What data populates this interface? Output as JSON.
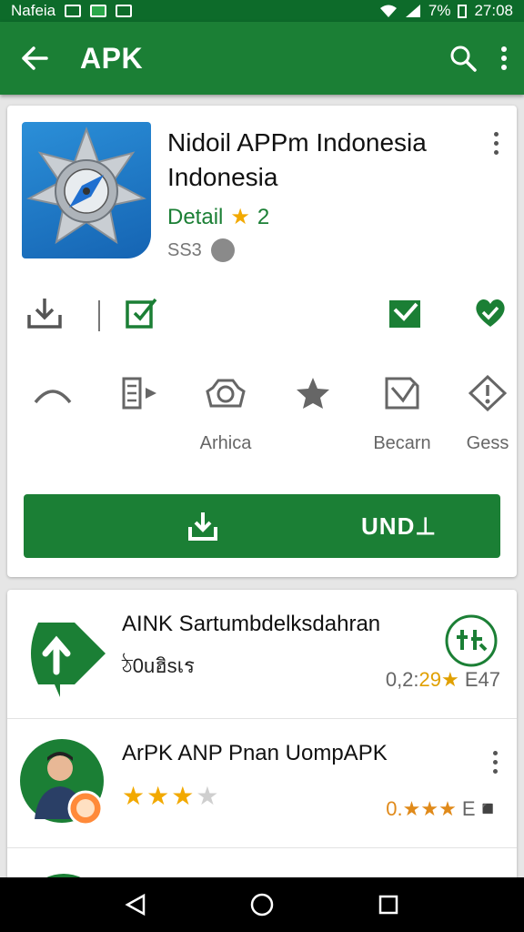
{
  "status_bar": {
    "carrier": "Nafeia",
    "battery": "7%",
    "time": "27:08"
  },
  "app_bar": {
    "title": "APK"
  },
  "detail": {
    "app_name": "Nidoil APPm Indonesia Indonesia",
    "detail_label": "Detail",
    "rating": "2",
    "price": "SS3",
    "categories": [
      "",
      "",
      "Arhica",
      "",
      "Becarn",
      "Gess"
    ],
    "install_label": "UND⊥"
  },
  "list": [
    {
      "name": "AINK Sartumbdelksdahran",
      "sub": "ঠ0uฮิsเร",
      "meta_prefix": "0,2:",
      "meta_highlight": "29★",
      "meta_suffix": " E47"
    },
    {
      "name": "ArPK ANP Pnan UompAPK",
      "meta_prefix": "0.",
      "meta_highlight": "★★★",
      "meta_suffix": " E◾"
    }
  ],
  "colors": {
    "primary": "#1b7f35",
    "status": "#0d6b2a",
    "star": "#f2a900"
  }
}
